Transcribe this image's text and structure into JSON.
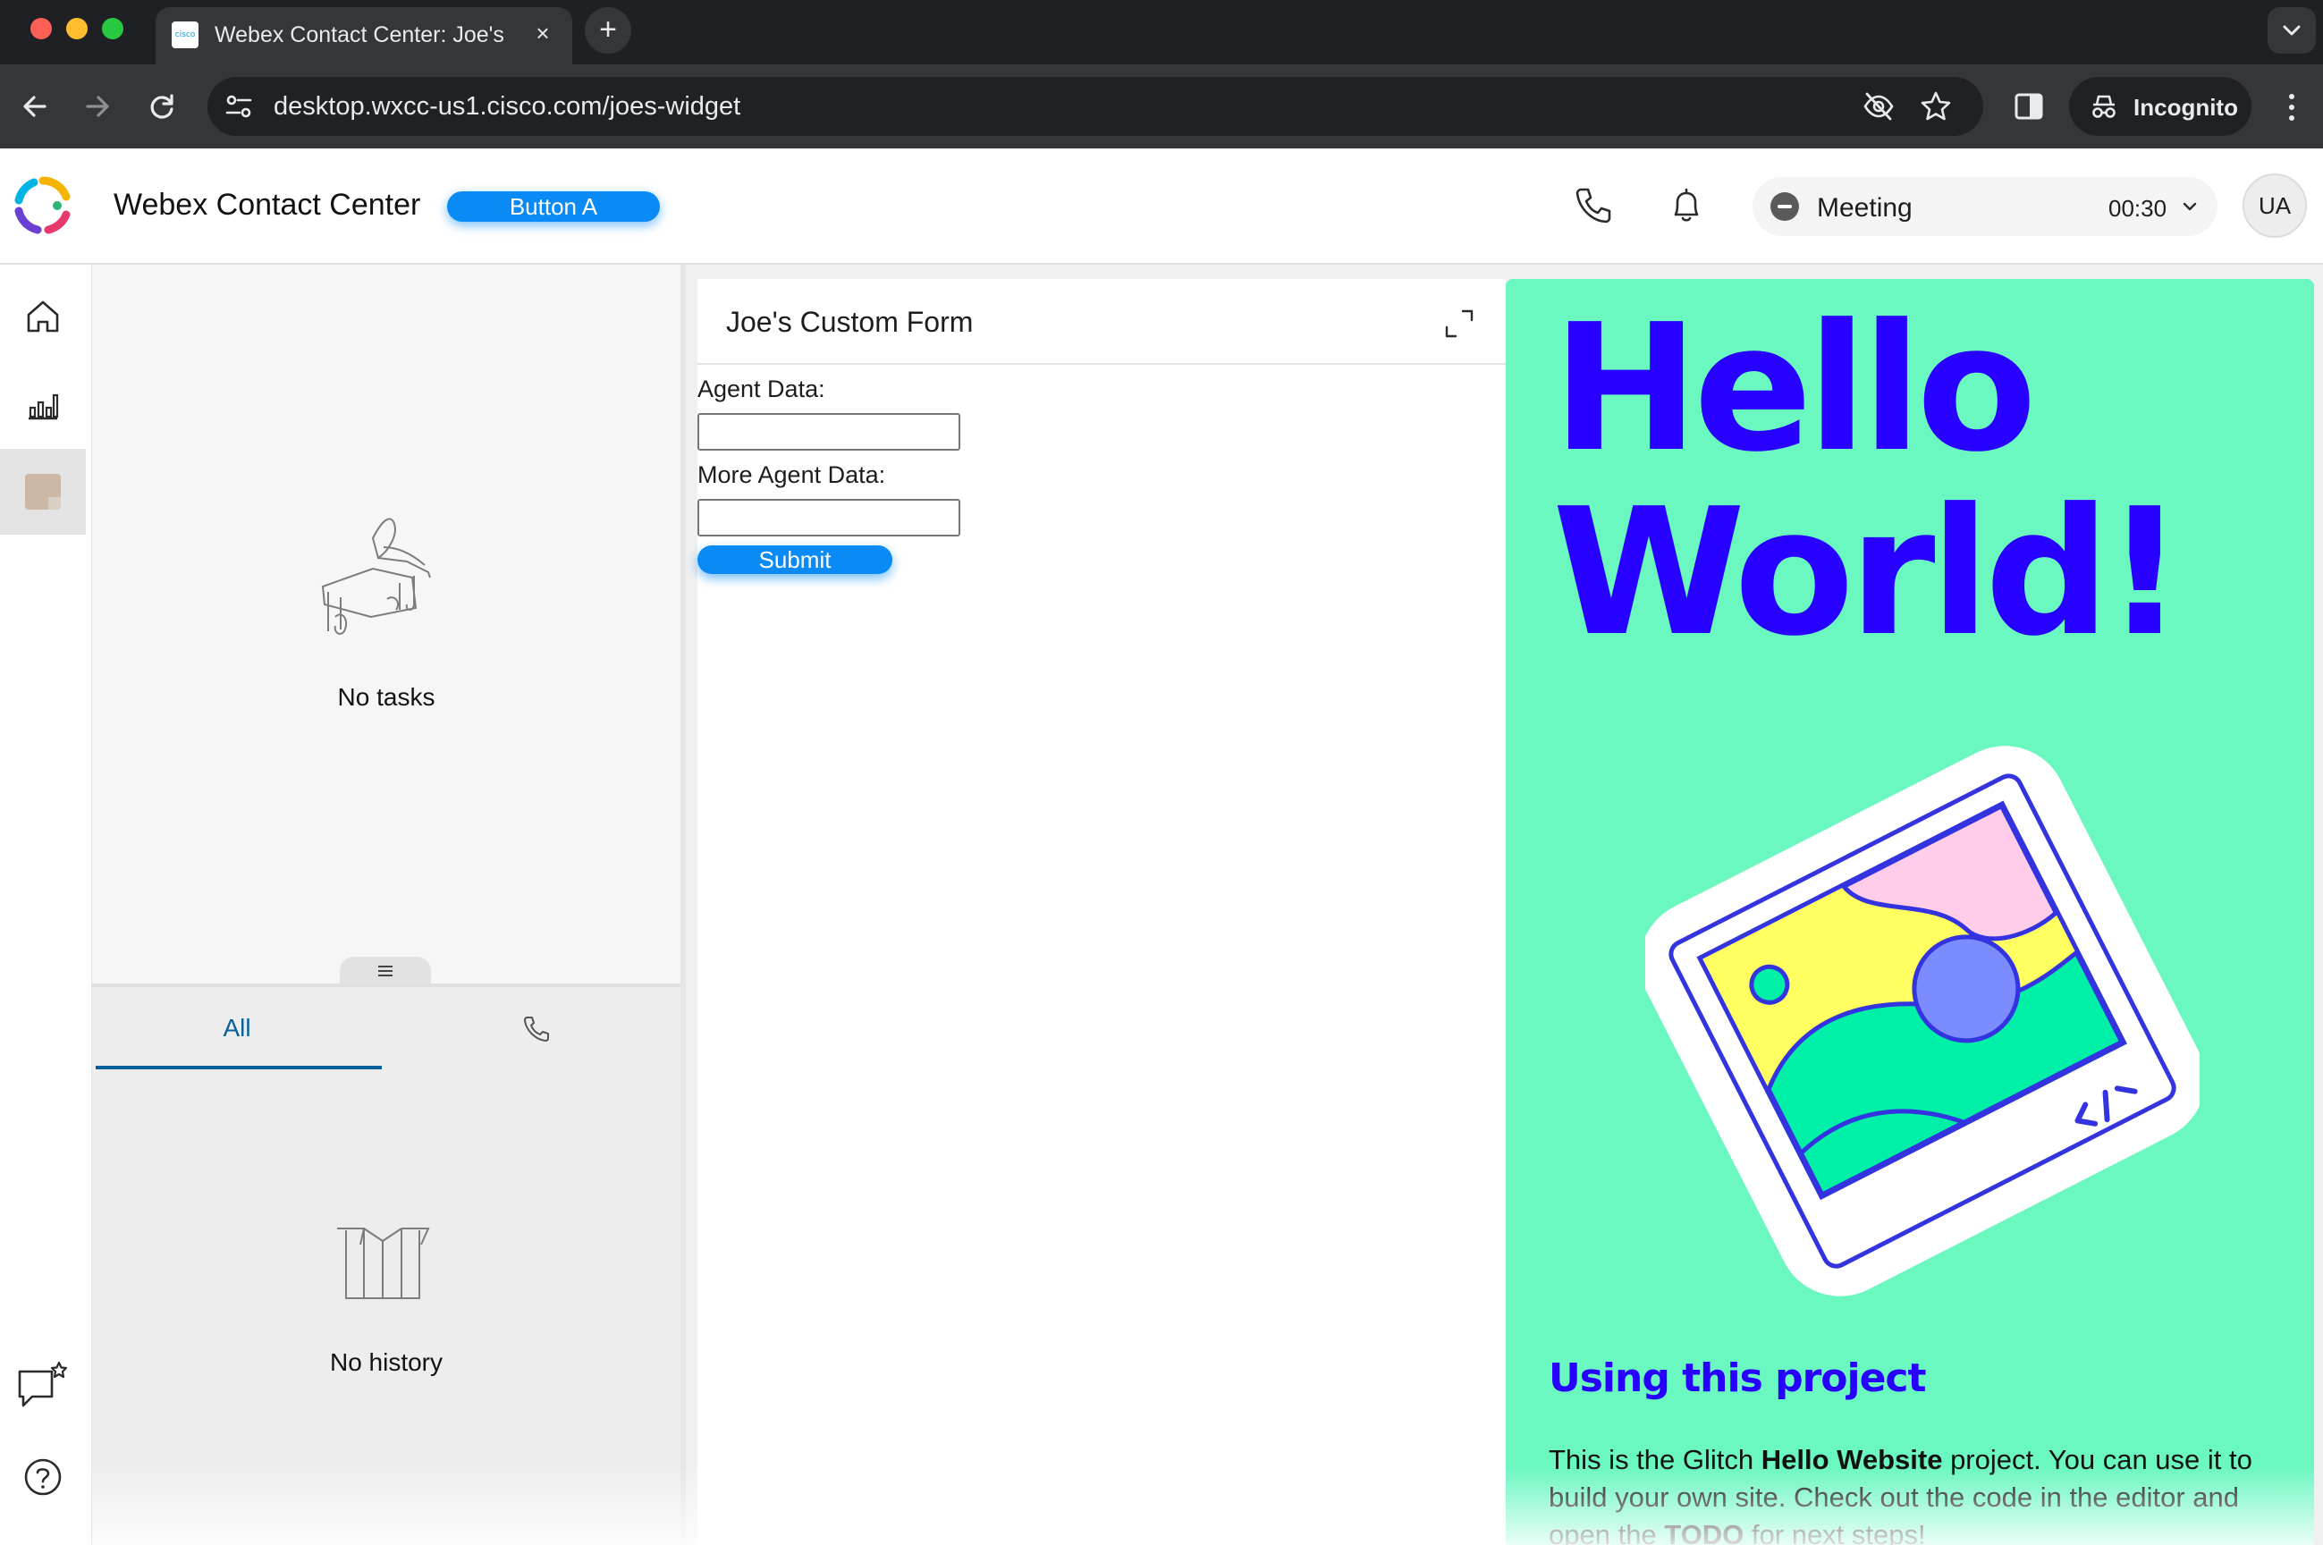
{
  "browser": {
    "tab_title": "Webex Contact Center: Joe's",
    "favicon_text": "cisco",
    "url": "desktop.wxcc-us1.cisco.com/joes-widget",
    "incognito_label": "Incognito",
    "icons": [
      "back-icon",
      "forward-icon",
      "reload-icon",
      "site-info-icon",
      "eye-off-icon",
      "star-icon",
      "side-panel-icon",
      "incognito-icon",
      "more-icon",
      "new-tab-icon",
      "tab-search-icon"
    ]
  },
  "header": {
    "title": "Webex Contact Center",
    "button_a_label": "Button A",
    "agent_state": {
      "label": "Meeting",
      "timer": "00:30"
    },
    "avatar_initials": "UA"
  },
  "left_nav": {
    "items": [
      "home-icon",
      "analytics-icon",
      "agent-photo",
      "feedback-icon",
      "help-icon"
    ]
  },
  "tasks": {
    "empty_label": "No tasks"
  },
  "history": {
    "tabs": [
      {
        "label": "All"
      },
      {
        "icon": "phone-icon"
      }
    ],
    "empty_label": "No history"
  },
  "custom_form": {
    "title": "Joe's Custom Form",
    "fields": [
      {
        "label": "Agent Data:",
        "value": ""
      },
      {
        "label": "More Agent Data:",
        "value": ""
      }
    ],
    "submit_label": "Submit"
  },
  "hello_site": {
    "heading_line1": "Hello",
    "heading_line2": "World!",
    "subheading": "Using this project",
    "body_prefix": "This is the Glitch ",
    "body_bold1": "Hello Website",
    "body_mid": " project. You can use it to build your own site. Check out the code in the editor and open the ",
    "body_bold2": "TODO",
    "body_suffix": " for next steps!",
    "colors": {
      "background": "#6af7c0",
      "heading": "#2800ff",
      "illustration_yellow": "#ffff62",
      "illustration_pink": "#ffcce9",
      "illustration_blue": "#7b8cff"
    }
  }
}
